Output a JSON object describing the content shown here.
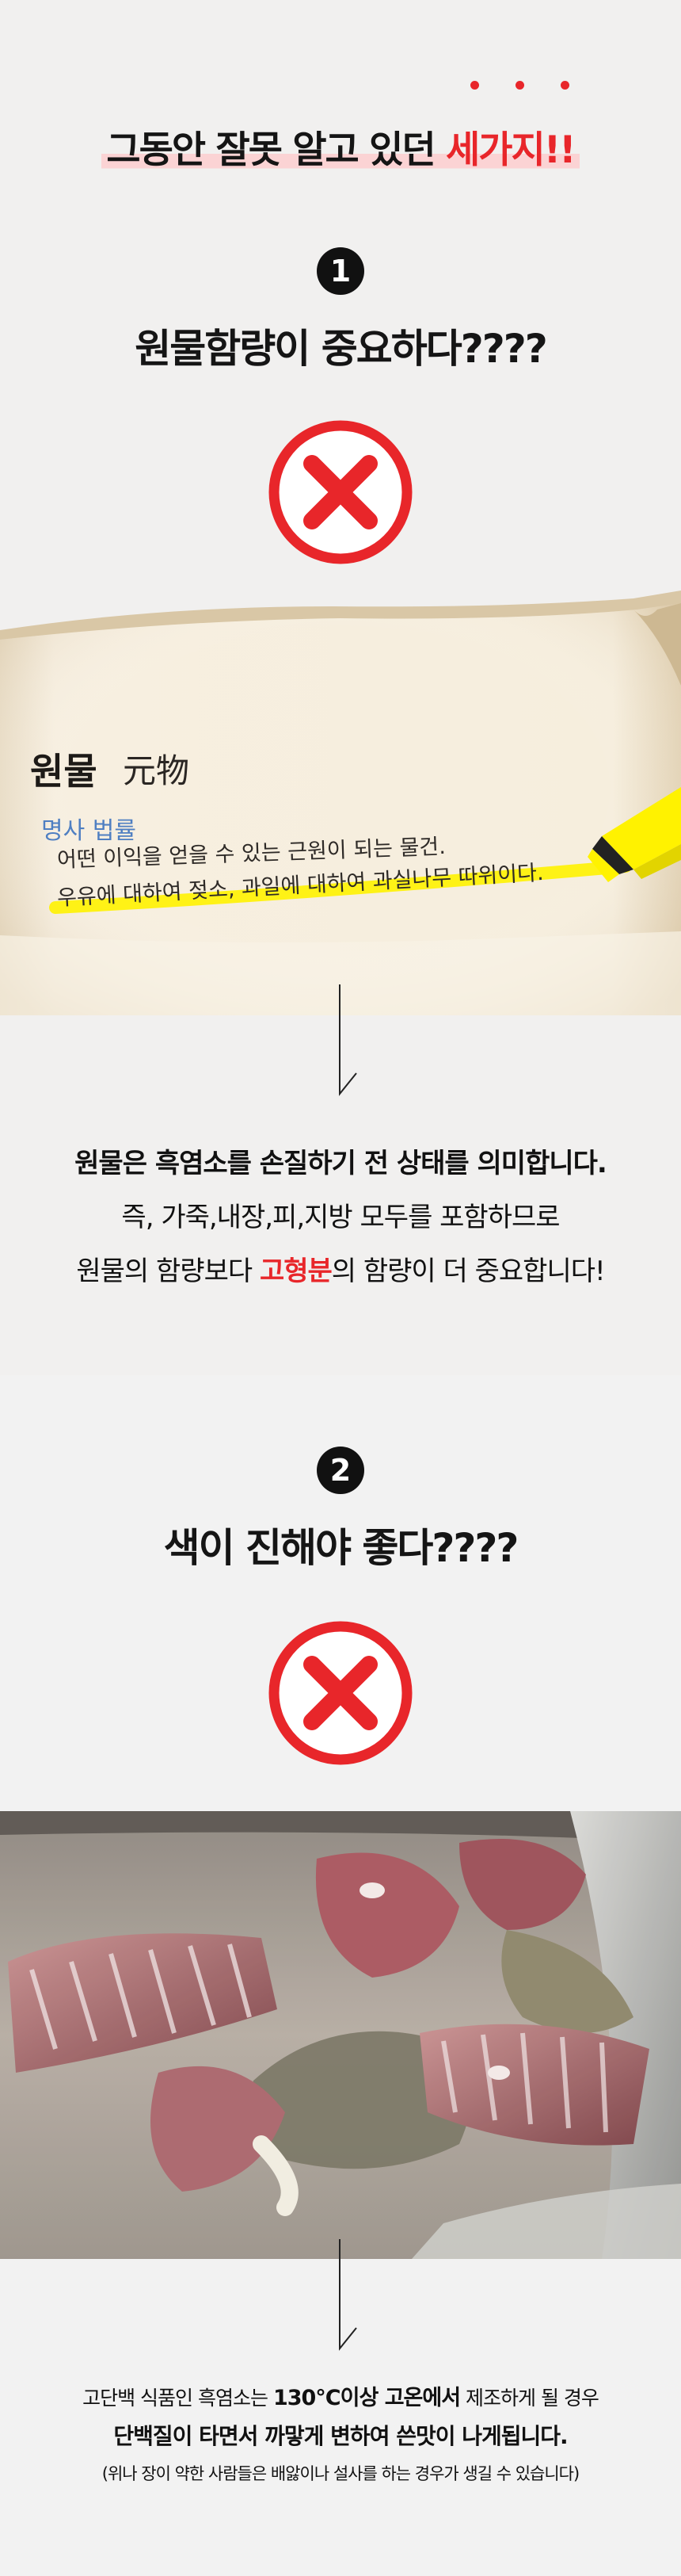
{
  "header": {
    "prefix": "그동안 잘못 알고 있던 ",
    "highlight": "세가지!!"
  },
  "section1": {
    "number": "1",
    "question": "원물함량이 중요하다????",
    "dictionary": {
      "word": "원물",
      "hanja": "元物",
      "pos": "명사 법률",
      "definition": "어떤 이익을 얻을 수 있는 근원이 되는 물건.",
      "example": "우유에 대하여 젖소, 과일에 대하여 과실나무 따위이다."
    },
    "line1": "원물은 흑염소를 손질하기 전 상태를 의미합니다.",
    "line2": "즉, 가죽,내장,피,지방 모두를 포함하므로",
    "line3_before": "원물의 함량보다 ",
    "line3_red": "고형분",
    "line3_after": "의 함량이 더 중요합니다!"
  },
  "section2": {
    "number": "2",
    "question": "색이 진해야 좋다????",
    "line1_before": "고단백 식품인 흑염소는 ",
    "line1_bold": "130°C이상 고온에서",
    "line1_after": " 제조하게 될 경우",
    "line2": "단백질이 타면서 까맣게 변하여 쓴맛이 나게됩니다.",
    "line3": "(위나 장이 약한 사람들은 배앓이나 설사를 하는 경우가 생길 수 있습니다)"
  },
  "colors": {
    "accent_red": "#e8262a",
    "highlight_pink": "#fbd3d4",
    "highlighter_yellow": "#fff200",
    "dict_blue": "#4f7fc2"
  },
  "icons": [
    "x-mark-icon",
    "down-arrow-icon",
    "highlighter-icon"
  ]
}
